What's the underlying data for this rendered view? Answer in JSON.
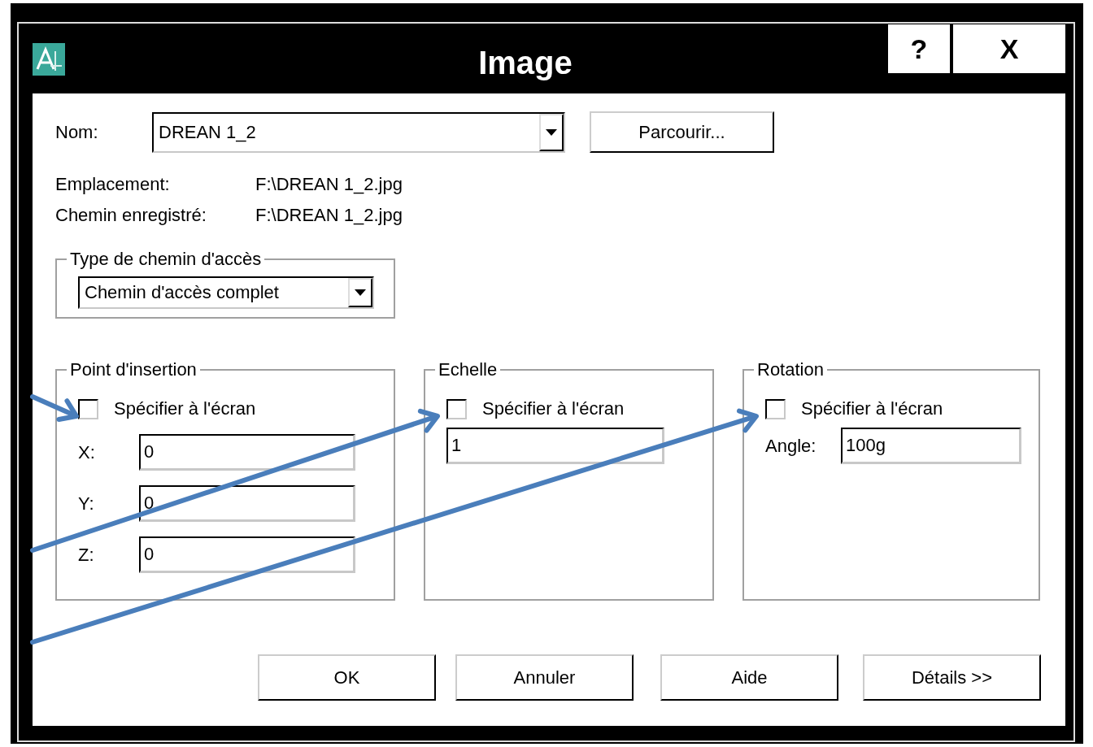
{
  "window": {
    "title": "Image"
  },
  "title_buttons": [
    {
      "kind": "help",
      "label": "?"
    },
    {
      "kind": "close",
      "label": "X"
    }
  ],
  "name": {
    "label": "Nom:",
    "value": "DREAN 1_2"
  },
  "browse_button": "Parcourir...",
  "info": [
    {
      "label": "Emplacement:",
      "value": "F:\\DREAN 1_2.jpg"
    },
    {
      "label": "Chemin enregistré:",
      "value": "F:\\DREAN 1_2.jpg"
    }
  ],
  "path_type": {
    "title": "Type de chemin d'accès",
    "value": "Chemin d'accès complet"
  },
  "groups": [
    {
      "title": "Point d'insertion",
      "checkbox": {
        "label": "Spécifier à l'écran",
        "checked": false
      },
      "fields": [
        {
          "label": "X:",
          "value": "0"
        },
        {
          "label": "Y:",
          "value": "0"
        },
        {
          "label": "Z:",
          "value": "0"
        }
      ]
    },
    {
      "title": "Echelle",
      "checkbox": {
        "label": "Spécifier à l'écran",
        "checked": false
      },
      "fields": [
        {
          "value": "1"
        }
      ]
    },
    {
      "title": "Rotation",
      "checkbox": {
        "label": "Spécifier à l'écran",
        "checked": false
      },
      "fields": [
        {
          "label": "Angle:",
          "value": "100g"
        }
      ]
    }
  ],
  "buttons": [
    "OK",
    "Annuler",
    "Aide",
    "Détails >>"
  ]
}
